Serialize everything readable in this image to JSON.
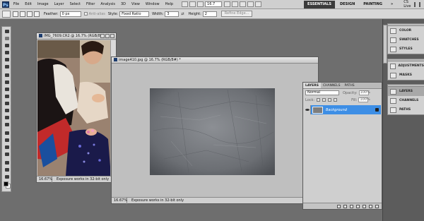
{
  "menubar": {
    "logo": "Ps",
    "items": [
      "File",
      "Edit",
      "Image",
      "Layer",
      "Select",
      "Filter",
      "Analysis",
      "3D",
      "View",
      "Window",
      "Help"
    ],
    "zoom": "16.7",
    "workspaces": [
      "ESSENTIALS",
      "DESIGN",
      "PAINTING"
    ],
    "active_workspace": "ESSENTIALS",
    "cs_live": "CS Live"
  },
  "options": {
    "feather_label": "Feather:",
    "feather_value": "0 px",
    "antialias_label": "Anti-alias",
    "style_label": "Style:",
    "style_value": "Fixed Ratio",
    "width_label": "Width:",
    "width_value": "3",
    "height_label": "Height:",
    "height_value": "2",
    "refine_edge": "Refine Edge..."
  },
  "doc1": {
    "title": "IMG_7609.CR2 @ 16.7% (RGB/8*)",
    "zoom": "16.67%",
    "status": "Exposure works in 32-bit only"
  },
  "doc2": {
    "title": "image410.jpg @ 16.7% (RGB/8#) *",
    "zoom": "16.67%",
    "status": "Exposure works in 32-bit only"
  },
  "layers_panel": {
    "tabs": [
      "LAYERS",
      "CHANNELS",
      "PATHS"
    ],
    "active_tab": "LAYERS",
    "blend_mode": "Normal",
    "opacity_label": "Opacity:",
    "opacity_value": "100%",
    "lock_label": "Lock:",
    "fill_label": "Fill:",
    "fill_value": "100%",
    "layer_name": "Background"
  },
  "dock": {
    "group1": [
      "COLOR",
      "SWATCHES",
      "STYLES"
    ],
    "group2": [
      "ADJUSTMENTS",
      "MASKS"
    ],
    "group3": [
      "LAYERS",
      "CHANNELS",
      "PATHS"
    ],
    "active": "LAYERS"
  },
  "colors": {
    "selection": "#3d8ee5",
    "foreground": "#000000",
    "background": "#ffffff"
  }
}
